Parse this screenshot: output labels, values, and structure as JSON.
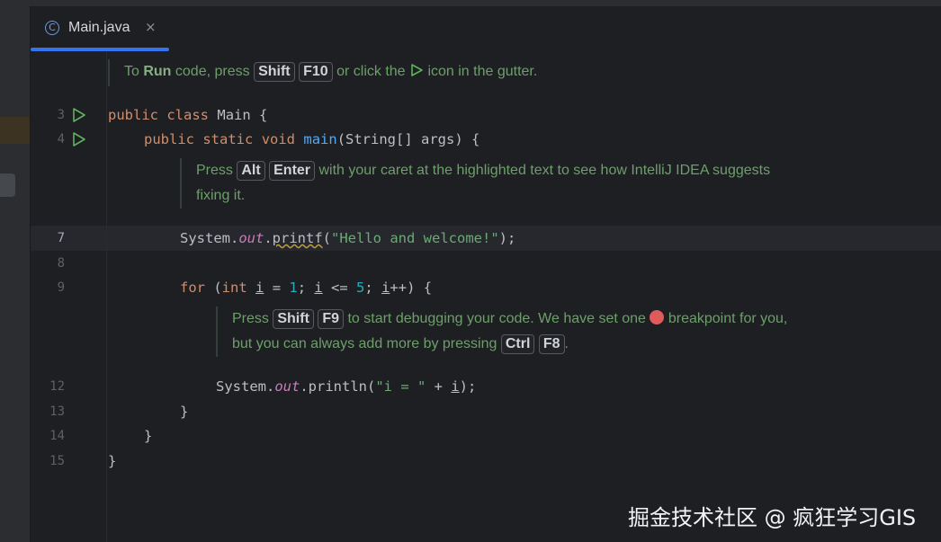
{
  "tab": {
    "icon": "class-c-icon",
    "label": "Main.java",
    "close": "×"
  },
  "hint_run": {
    "p1": "To ",
    "bold": "Run",
    "p2": " code, press ",
    "k1": "Shift",
    "k2": "F10",
    "p3": " or click the ",
    "p4": " icon in the gutter."
  },
  "gutter": {
    "l3": "3",
    "l4": "4",
    "l7": "7",
    "l8": "8",
    "l9": "9",
    "l12": "12",
    "l13": "13",
    "l14": "14",
    "l15": "15"
  },
  "code": {
    "l3": {
      "kw1": "public",
      "kw2": "class",
      "name": "Main",
      "brace": "{"
    },
    "l4": {
      "kw1": "public",
      "kw2": "static",
      "kw3": "void",
      "fn": "main",
      "params": "(String[] args) {"
    },
    "l7": {
      "obj": "System.",
      "fld": "out",
      "dot": ".",
      "fn": "printf",
      "open": "(",
      "str": "\"Hello and welcome!\"",
      "close": ");"
    },
    "l9": {
      "kw": "for",
      "p1": " (",
      "kw2": "int",
      "sp": " ",
      "v1": "i",
      "p2": " = ",
      "n1": "1",
      "p3": "; ",
      "v2": "i",
      "p4": " <= ",
      "n2": "5",
      "p5": "; ",
      "v3": "i",
      "p6": "++) {"
    },
    "l12": {
      "obj": "System.",
      "fld": "out",
      "rest": ".println(",
      "str": "\"i = \"",
      "plus": " + ",
      "v": "i",
      "close": ");"
    },
    "l13": "}",
    "l14": "}",
    "l15": "}"
  },
  "hint_alt": {
    "p1": "Press ",
    "k1": "Alt",
    "k2": "Enter",
    "p2": " with your caret at the highlighted text to see how IntelliJ IDEA suggests",
    "p3": "fixing it."
  },
  "hint_debug": {
    "p1": "Press ",
    "k1": "Shift",
    "k2": "F9",
    "p2": " to start debugging your code. We have set one ",
    "p3": " breakpoint for you,",
    "p4": "but you can always add more by pressing ",
    "k3": "Ctrl",
    "k4": "F8",
    "p5": "."
  },
  "watermark": "掘金技术社区 @ 疯狂学习GIS",
  "colors": {
    "keyword": "#cf8e6d",
    "function": "#56a8f5",
    "string": "#6aab73",
    "number": "#2aacb8",
    "field": "#c77dbb",
    "doc": "#6d9f6b",
    "accent": "#3574f0",
    "breakpoint": "#e05c5c"
  }
}
